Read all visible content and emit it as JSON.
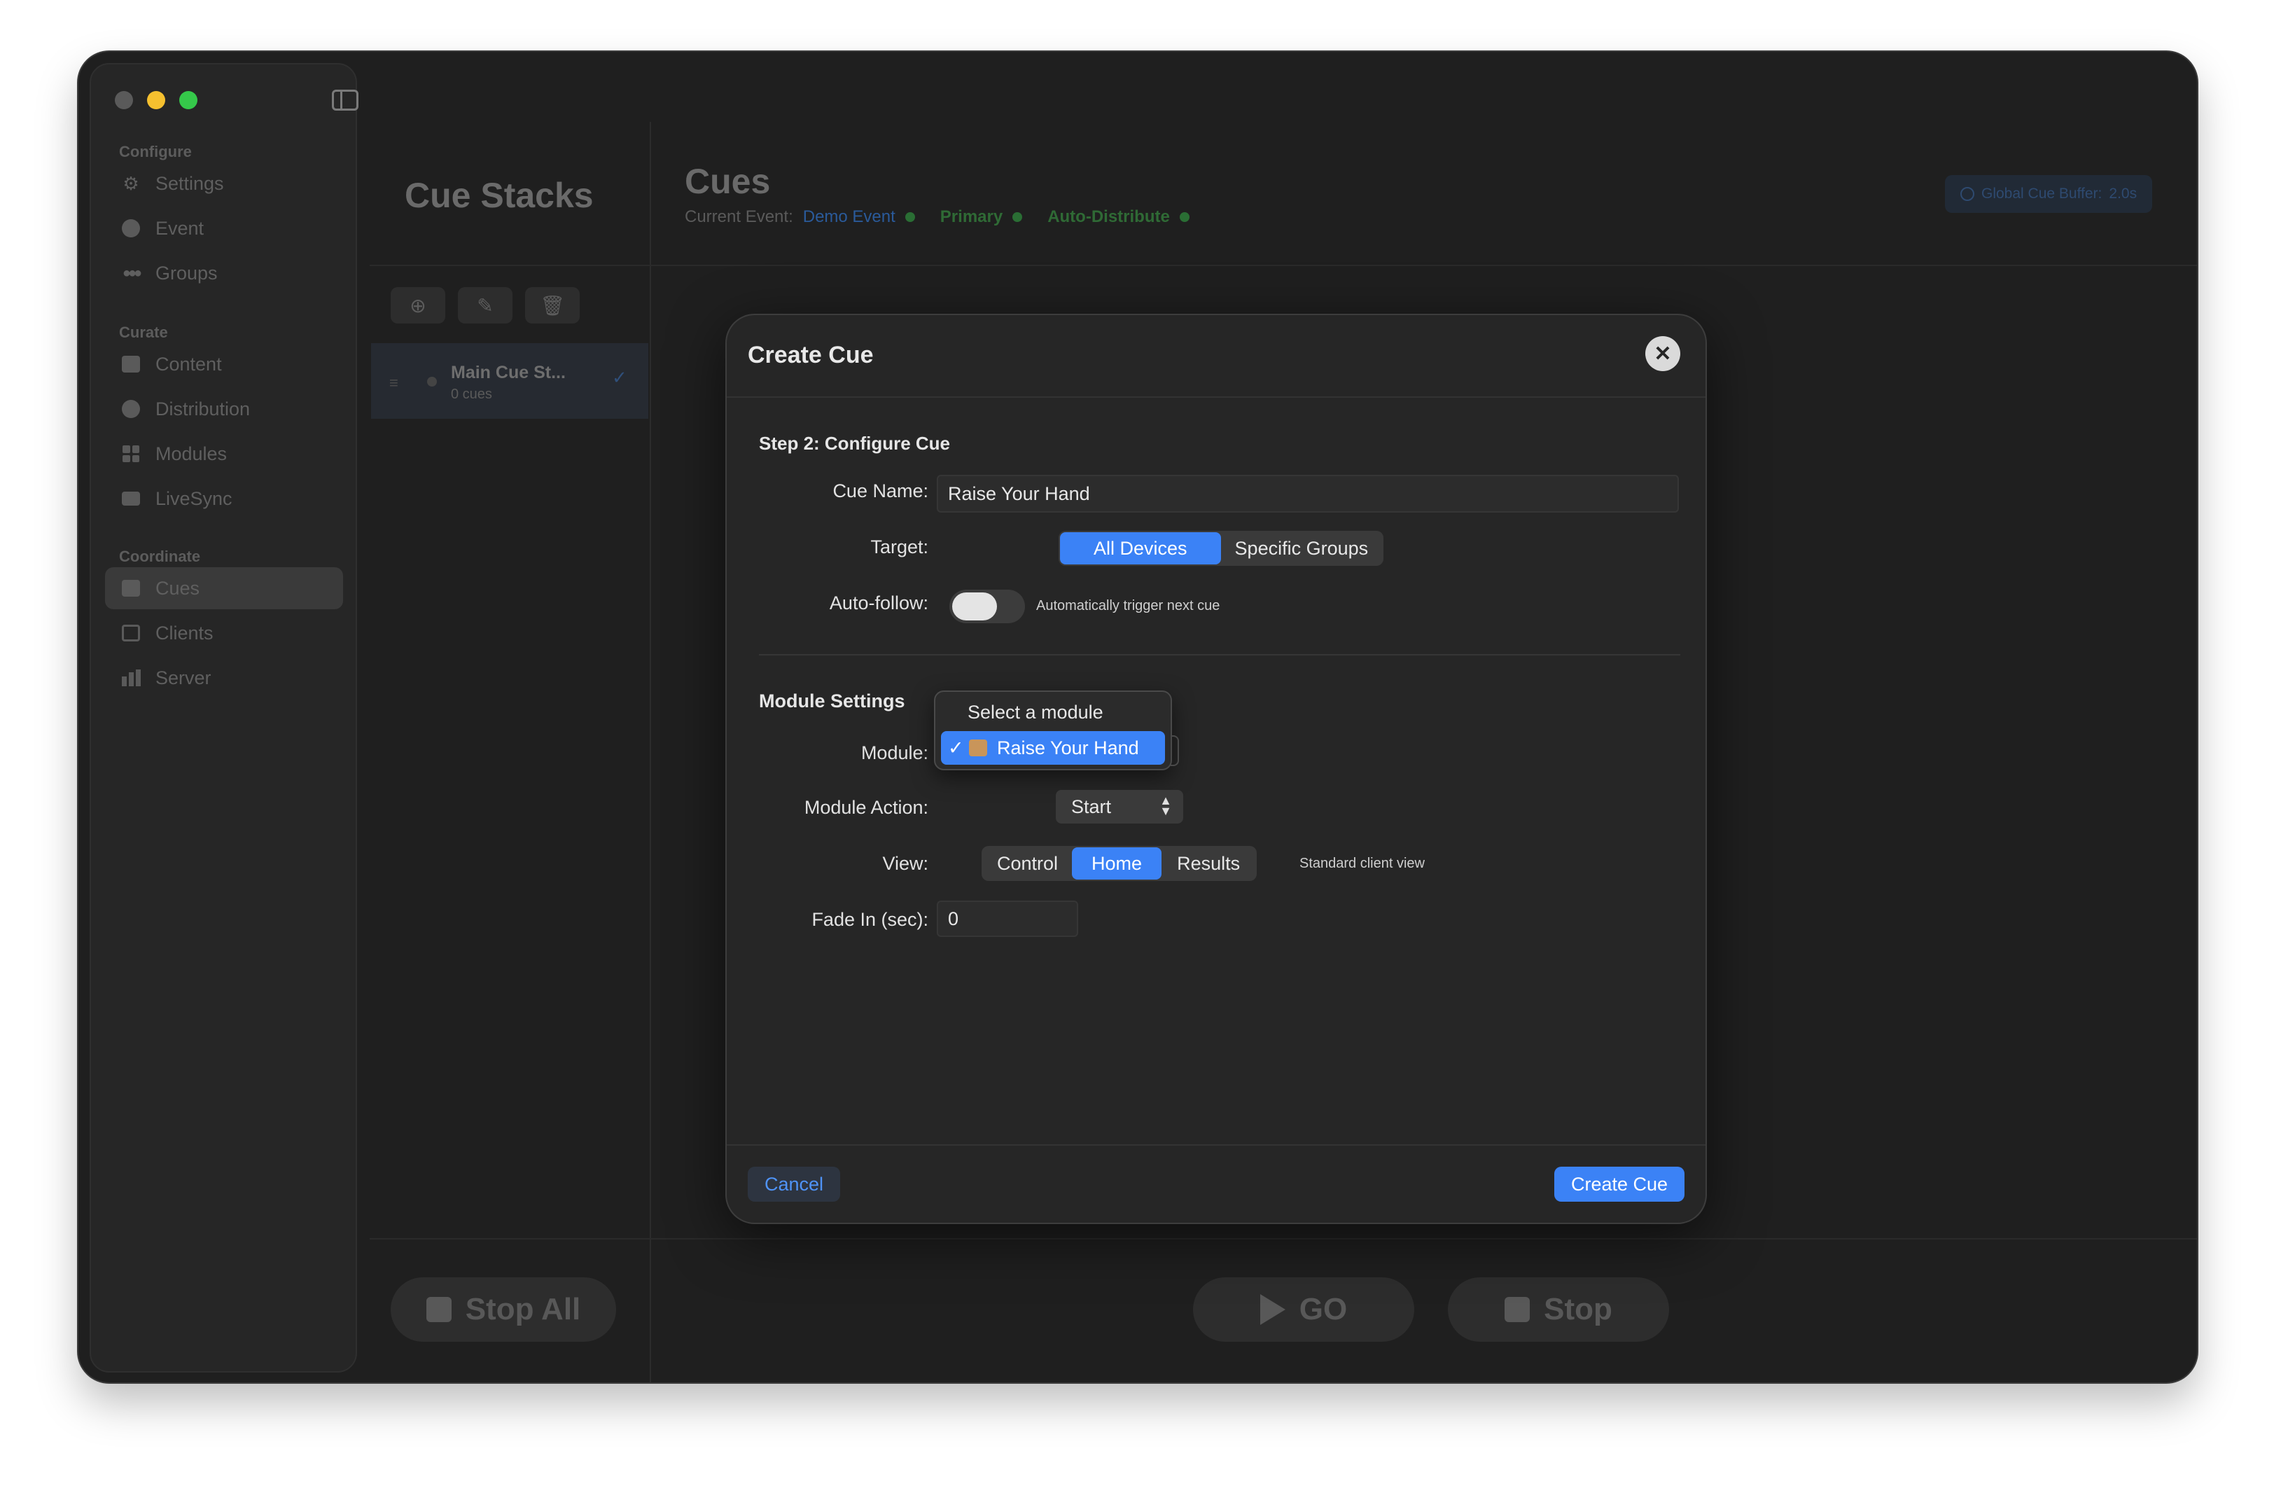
{
  "sidebar": {
    "sections": [
      {
        "label": "Configure",
        "items": [
          {
            "label": "Settings",
            "icon": "gear-icon"
          },
          {
            "label": "Event",
            "icon": "event-icon"
          },
          {
            "label": "Groups",
            "icon": "groups-icon"
          }
        ]
      },
      {
        "label": "Curate",
        "items": [
          {
            "label": "Content",
            "icon": "content-icon"
          },
          {
            "label": "Distribution",
            "icon": "distribution-icon"
          },
          {
            "label": "Modules",
            "icon": "modules-icon"
          },
          {
            "label": "LiveSync",
            "icon": "camera-icon"
          }
        ]
      },
      {
        "label": "Coordinate",
        "items": [
          {
            "label": "Cues",
            "icon": "cues-icon",
            "active": true
          },
          {
            "label": "Clients",
            "icon": "clients-icon"
          },
          {
            "label": "Server",
            "icon": "server-icon"
          }
        ]
      }
    ]
  },
  "cue_stacks": {
    "title": "Cue Stacks",
    "toolbar": {
      "add": "add-icon",
      "edit": "pencil-icon",
      "delete": "trash-icon"
    },
    "items": [
      {
        "name": "Main Cue St...",
        "count": "0 cues",
        "selected": true
      }
    ],
    "stop_all_label": "Stop All"
  },
  "cues": {
    "title": "Cues",
    "current_event_label": "Current Event:",
    "event_name": "Demo Event",
    "mode": "Primary",
    "distribution": "Auto-Distribute",
    "global_buffer_label": "Global Cue Buffer:",
    "global_buffer_value": "2.0s",
    "go_label": "GO",
    "stop_label": "Stop"
  },
  "modal": {
    "title": "Create Cue",
    "step_title": "Step 2: Configure Cue",
    "cue_name_label": "Cue Name:",
    "cue_name_value": "Raise Your Hand",
    "target_label": "Target:",
    "target_options": [
      "All Devices",
      "Specific Groups"
    ],
    "target_selected": "All Devices",
    "auto_follow_label": "Auto-follow:",
    "auto_follow_on": false,
    "auto_follow_note": "Automatically trigger next cue",
    "module_settings_title": "Module Settings",
    "module_label": "Module:",
    "module_menu": {
      "placeholder": "Select a module",
      "selected": "Raise Your Hand",
      "check": "✓"
    },
    "module_action_label": "Module Action:",
    "module_action_value": "Start",
    "view_label": "View:",
    "view_options": [
      "Control",
      "Home",
      "Results"
    ],
    "view_selected": "Home",
    "view_note": "Standard client view",
    "fade_in_label": "Fade In (sec):",
    "fade_in_value": "0",
    "cancel_label": "Cancel",
    "create_label": "Create Cue"
  },
  "colors": {
    "accent": "#3b82f6",
    "success": "#2f6a35",
    "link": "#2a5a9a"
  }
}
